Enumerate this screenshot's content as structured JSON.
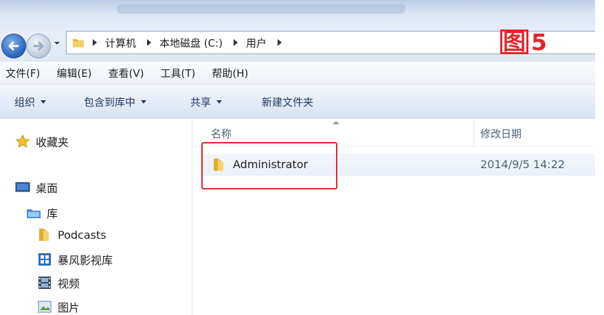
{
  "address_bar": {
    "breadcrumbs": [
      "计算机",
      "本地磁盘 (C:)",
      "用户"
    ],
    "figure_label_hanzi": "图",
    "figure_label_number": "5"
  },
  "menu": [
    "文件(F)",
    "编辑(E)",
    "查看(V)",
    "工具(T)",
    "帮助(H)"
  ],
  "toolbar": {
    "organize": "组织",
    "include_in_library": "包含到库中",
    "share": "共享",
    "new_folder": "新建文件夹"
  },
  "nav_pane": {
    "favorites": "收藏夹",
    "desktop": "桌面",
    "libraries": "库",
    "library_items": [
      "Podcasts",
      "暴风影视库",
      "视频",
      "图片"
    ]
  },
  "file_list": {
    "columns": {
      "name": "名称",
      "modified": "修改日期"
    },
    "rows": [
      {
        "name": "Administrator",
        "modified": "2014/9/5 14:22"
      }
    ]
  },
  "colors": {
    "highlight_box": "#d8262c",
    "figure_label": "#e2262b"
  }
}
